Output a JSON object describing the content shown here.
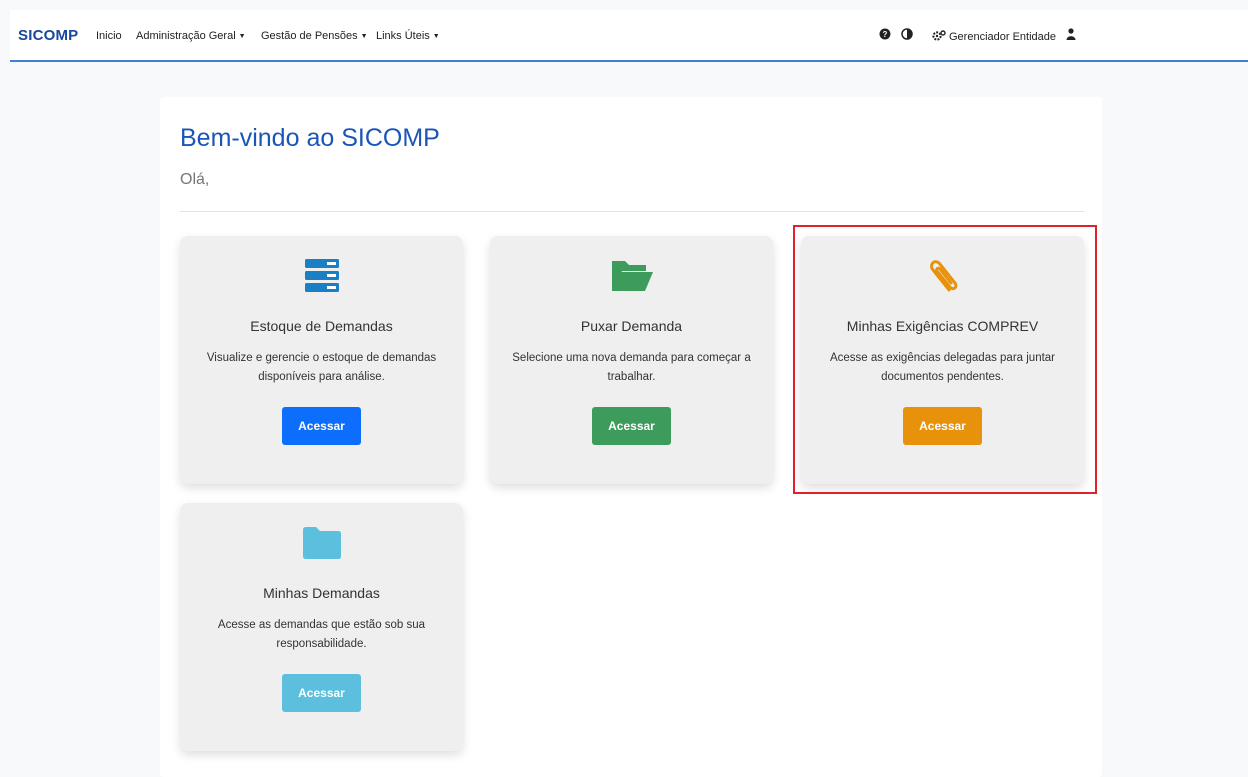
{
  "navbar": {
    "brand": "SICOMP",
    "items": [
      {
        "label": "Inicio",
        "dropdown": false
      },
      {
        "label": "Administração Geral",
        "dropdown": true
      },
      {
        "label": "Gestão de Pensões",
        "dropdown": true
      },
      {
        "label": "Links Úteis",
        "dropdown": true
      }
    ],
    "caret": "▼",
    "right": {
      "help_icon": "question-circle-icon",
      "contrast_icon": "contrast-icon",
      "entity_icon": "gears-icon",
      "entity_label": "Gerenciador Entidade",
      "user_icon": "user-icon"
    },
    "accent_color": "#3f7fd6"
  },
  "welcome": {
    "title": "Bem-vindo ao SICOMP",
    "greeting": "Olá,"
  },
  "cards": [
    {
      "icon": "server-stack-icon",
      "title": "Estoque de Demandas",
      "description": "Visualize e gerencie o estoque de demandas disponíveis para análise.",
      "button": "Acessar",
      "color": "#0d6efd"
    },
    {
      "icon": "folder-open-icon",
      "title": "Puxar Demanda",
      "description": "Selecione uma nova demanda para começar a trabalhar.",
      "button": "Acessar",
      "color": "#3d9b5c"
    },
    {
      "icon": "paperclip-icon",
      "title": "Minhas Exigências COMPREV",
      "description": "Acesse as exigências delegadas para juntar documentos pendentes.",
      "button": "Acessar",
      "color": "#e8920c"
    },
    {
      "icon": "folder-icon",
      "title": "Minhas Demandas",
      "description": "Acesse as demandas que estão sob sua responsabilidade.",
      "button": "Acessar",
      "color": "#5bbfdd"
    }
  ],
  "highlight_color": "#e0202b"
}
